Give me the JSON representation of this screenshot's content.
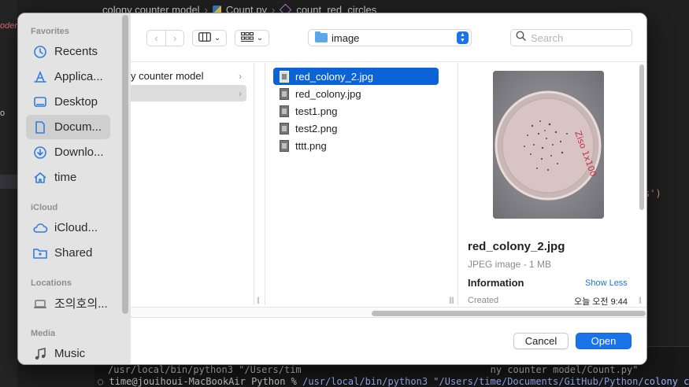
{
  "background": {
    "breadcrumb": [
      "colony counter model",
      "Count.py",
      "count_red_circles"
    ],
    "left_label": "oder",
    "left_char": "o",
    "code_fragment": "s')",
    "terminal": {
      "line1_a": "/usr/local/bin/python3 \"/Users/tim",
      "line1_b": "ny counter model/Count.py\"",
      "prompt": "time@jouihoui-MacBookAir Python % ",
      "command": "/usr/local/bin/python3 \"/Users/time/Documents/GitHub/Python/colony count"
    }
  },
  "sidebar": {
    "sections": {
      "favorites": "Favorites",
      "icloud": "iCloud",
      "locations": "Locations",
      "media": "Media"
    },
    "items": [
      {
        "label": "Recents",
        "icon": "clock-icon"
      },
      {
        "label": "Applica...",
        "icon": "applications-icon"
      },
      {
        "label": "Desktop",
        "icon": "desktop-icon"
      },
      {
        "label": "Docum...",
        "icon": "document-icon",
        "selected": true
      },
      {
        "label": "Downlo...",
        "icon": "download-icon"
      },
      {
        "label": "time",
        "icon": "home-icon"
      },
      {
        "label": "iCloud...",
        "icon": "cloud-icon"
      },
      {
        "label": "Shared",
        "icon": "shared-folder-icon"
      },
      {
        "label": "조의호의...",
        "icon": "laptop-icon"
      },
      {
        "label": "Music",
        "icon": "music-icon"
      }
    ]
  },
  "toolbar": {
    "path": "image",
    "search_placeholder": "Search"
  },
  "columns": {
    "col1": [
      {
        "label": "y counter model",
        "has_children": true
      },
      {
        "label": "",
        "has_children": true,
        "selected": true
      }
    ],
    "files": [
      {
        "name": "red_colony_2.jpg",
        "selected": true
      },
      {
        "name": "red_colony.jpg"
      },
      {
        "name": "test1.png"
      },
      {
        "name": "test2.png"
      },
      {
        "name": "tttt.png"
      }
    ]
  },
  "preview": {
    "name": "red_colony_2.jpg",
    "kind": "JPEG image - 1 MB",
    "info_label": "Information",
    "show_less": "Show Less",
    "created_label": "Created",
    "created_value": "오늘 오전 9:44",
    "dish_label": "Ziso\n1x100"
  },
  "footer": {
    "cancel": "Cancel",
    "open": "Open"
  },
  "colors": {
    "accent": "#1a73e8",
    "selection": "#0a64d8",
    "sidebar_bg": "#e4e3e3"
  }
}
